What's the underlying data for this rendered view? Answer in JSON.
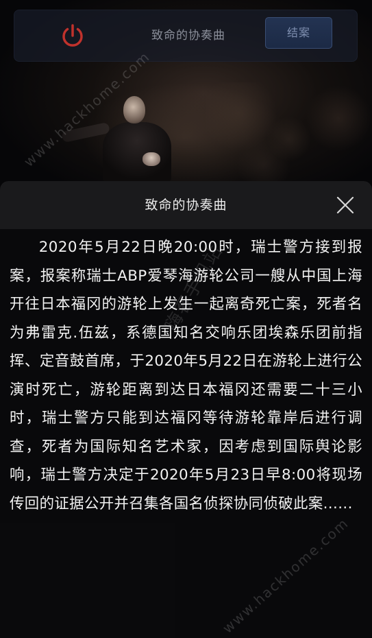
{
  "topbar": {
    "power_icon": "power-icon",
    "title": "致命的协奏曲",
    "close_case_label": "结案",
    "accent_color": "#c0322c"
  },
  "modal": {
    "title": "致命的协奏曲",
    "close_icon": "close-icon",
    "story": "2020年5月22日晚20:00时，瑞士警方接到报案，报案称瑞士ABP爱琴海游轮公司一艘从中国上海开往日本福冈的游轮上发生一起离奇死亡案，死者名为弗雷克.伍兹，系德国知名交响乐团埃森乐团前指挥、定音鼓首席，于2020年5月22日在游轮上进行公演时死亡，游轮距离到达日本福冈还需要二十三小时，瑞士警方只能到达福冈等待游轮靠岸后进行调查，死者为国际知名艺术家，因考虑到国际舆论影响，瑞士警方决定于2020年5月23日早8:00将现场传回的证据公开并召集各国名侦探协同侦破此案......"
  },
  "watermark": {
    "text_primary": "www.hackhome.com",
    "text_secondary": "嗨客手机站"
  }
}
